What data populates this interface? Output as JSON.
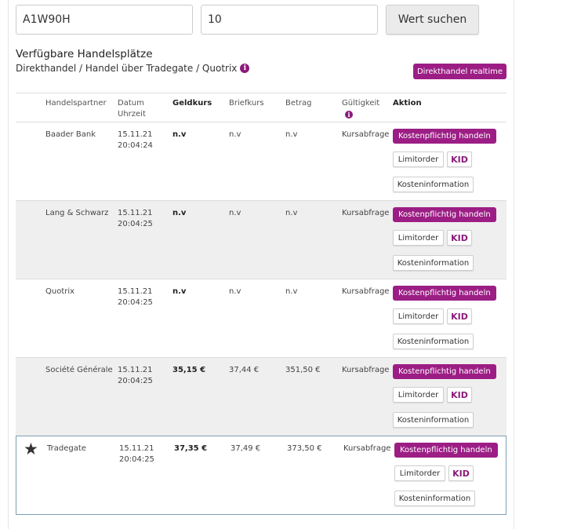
{
  "search": {
    "wkn_value": "A1W90H",
    "quantity_value": "10",
    "button_label": "Wert suchen"
  },
  "section": {
    "title": "Verfügbare Handelsplätze",
    "subtitle": "Direkthandel / Handel über Tradegate / Quotrix",
    "realtime_label": "Direkthandel realtime"
  },
  "columns": {
    "partner": "Handelspartner",
    "datum": "Datum",
    "uhrzeit": "Uhrzeit",
    "geldkurs": "Geldkurs",
    "briefkurs": "Briefkurs",
    "betrag": "Betrag",
    "gueltigkeit": "Gültigkeit",
    "aktion": "Aktion"
  },
  "icons": {
    "info": "info-icon",
    "favorite": "star-icon"
  },
  "colors": {
    "accent": "#9c1e85",
    "row_shade": "#efefef",
    "highlight_border": "#7d9fb3"
  },
  "rows": [
    {
      "partner": "Baader Bank",
      "date": "15.11.21",
      "time": "20:04:24",
      "geldkurs": "n.v",
      "briefkurs": "n.v",
      "betrag": "n.v",
      "gueltigkeit": "Kursabfrage",
      "trade_label": "Kostenpflichtig handeln",
      "limit_label": "Limitorder",
      "kid_label": "KID",
      "cost_label": "Kosteninformation"
    },
    {
      "partner": "Lang & Schwarz",
      "date": "15.11.21",
      "time": "20:04:25",
      "geldkurs": "n.v",
      "briefkurs": "n.v",
      "betrag": "n.v",
      "gueltigkeit": "Kursabfrage",
      "trade_label": "Kostenpflichtig handeln",
      "limit_label": "Limitorder",
      "kid_label": "KID",
      "cost_label": "Kosteninformation"
    },
    {
      "partner": "Quotrix",
      "date": "15.11.21",
      "time": "20:04:25",
      "geldkurs": "n.v",
      "briefkurs": "n.v",
      "betrag": "n.v",
      "gueltigkeit": "Kursabfrage",
      "trade_label": "Kostenpflichtig handeln",
      "limit_label": "Limitorder",
      "kid_label": "KID",
      "cost_label": "Kosteninformation"
    },
    {
      "partner": "Société Générale",
      "date": "15.11.21",
      "time": "20:04:25",
      "geldkurs": "35,15 €",
      "briefkurs": "37,44 €",
      "betrag": "351,50 €",
      "gueltigkeit": "Kursabfrage",
      "trade_label": "Kostenpflichtig handeln",
      "limit_label": "Limitorder",
      "kid_label": "KID",
      "cost_label": "Kosteninformation"
    },
    {
      "partner": "Tradegate",
      "date": "15.11.21",
      "time": "20:04:25",
      "geldkurs": "37,35 €",
      "briefkurs": "37,49 €",
      "betrag": "373,50 €",
      "gueltigkeit": "Kursabfrage",
      "trade_label": "Kostenpflichtig handeln",
      "limit_label": "Limitorder",
      "kid_label": "KID",
      "cost_label": "Kosteninformation"
    }
  ]
}
